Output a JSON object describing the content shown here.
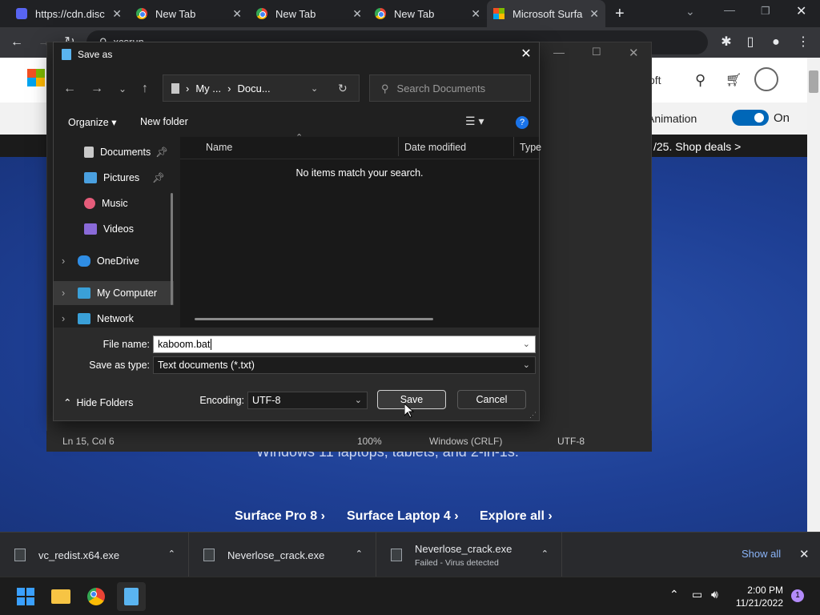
{
  "browser": {
    "tabs": [
      {
        "title": "https://cdn.disc",
        "icon": "discord-icon"
      },
      {
        "title": "New Tab",
        "icon": "chrome-icon"
      },
      {
        "title": "New Tab",
        "icon": "chrome-icon"
      },
      {
        "title": "New Tab",
        "icon": "chrome-icon"
      },
      {
        "title": "Microsoft Surfa",
        "icon": "microsoft-icon"
      }
    ],
    "new_tab_glyph": "+",
    "omnibox_value": "xcsrun"
  },
  "webpage": {
    "signin_text": "oft",
    "animation_label": "Animation",
    "animation_toggle_state": "On",
    "promo_text": "/25. Shop deals >",
    "hero_subtitle": "Windows 11 laptops, tablets, and 2-in-1s.",
    "links": [
      "Surface Pro 8",
      "Surface Laptop 4",
      "Explore all"
    ]
  },
  "notepad": {
    "status": {
      "position": "Ln 15, Col 6",
      "zoom": "100%",
      "line_ending": "Windows (CRLF)",
      "encoding": "UTF-8"
    }
  },
  "dialog": {
    "title": "Save as",
    "address": {
      "seg1": "My ...",
      "seg2": "Docu..."
    },
    "search_placeholder": "Search Documents",
    "toolbar": {
      "organize": "Organize",
      "new_folder": "New folder"
    },
    "nav": [
      {
        "label": "Documents",
        "pinned": true
      },
      {
        "label": "Pictures",
        "pinned": true
      },
      {
        "label": "Music",
        "pinned": false
      },
      {
        "label": "Videos",
        "pinned": false
      },
      {
        "label": "OneDrive",
        "pinned": false
      },
      {
        "label": "My Computer",
        "pinned": false
      },
      {
        "label": "Network",
        "pinned": false
      }
    ],
    "columns": [
      "Name",
      "Date modified",
      "Type"
    ],
    "empty_message": "No items match your search.",
    "file_name_label": "File name:",
    "file_name_value": "kaboom.bat",
    "save_type_label": "Save as type:",
    "save_type_value": "Text documents (*.txt)",
    "hide_folders": "Hide Folders",
    "encoding_label": "Encoding:",
    "encoding_value": "UTF-8",
    "save_button": "Save",
    "cancel_button": "Cancel"
  },
  "downloads": {
    "items": [
      {
        "name": "vc_redist.x64.exe",
        "status": ""
      },
      {
        "name": "Neverlose_crack.exe",
        "status": ""
      },
      {
        "name": "Neverlose_crack.exe",
        "status": "Failed - Virus detected"
      }
    ],
    "show_all": "Show all"
  },
  "taskbar": {
    "time": "2:00 PM",
    "date": "11/21/2022",
    "notification_count": "1"
  }
}
